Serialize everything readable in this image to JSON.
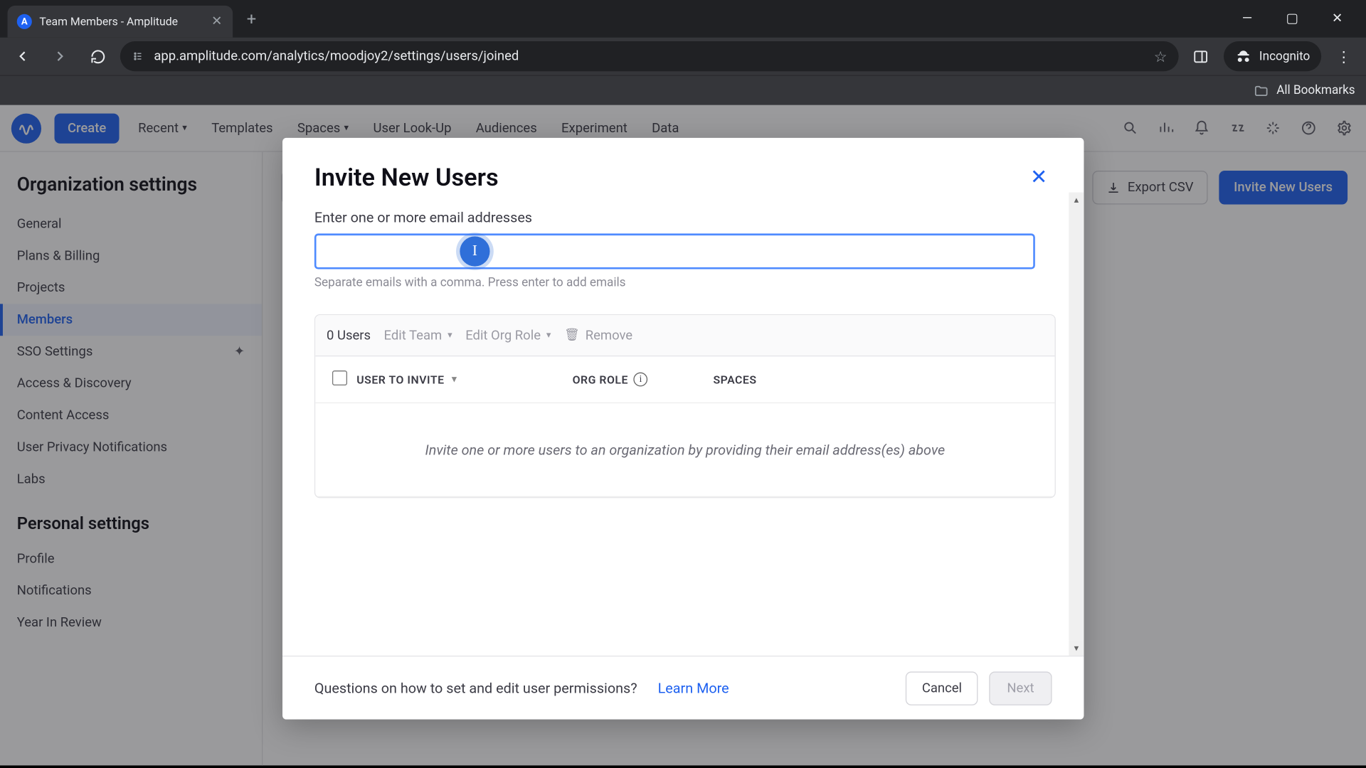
{
  "browser": {
    "tab_title": "Team Members - Amplitude",
    "url": "app.amplitude.com/analytics/moodjoy2/settings/users/joined",
    "incognito_label": "Incognito",
    "all_bookmarks": "All Bookmarks"
  },
  "app": {
    "create_label": "Create",
    "top_nav": {
      "recent": "Recent",
      "templates": "Templates",
      "spaces": "Spaces",
      "user_lookup": "User Look-Up",
      "audiences": "Audiences",
      "experiment": "Experiment",
      "data": "Data"
    },
    "sidebar": {
      "org_heading": "Organization settings",
      "personal_heading": "Personal settings",
      "items": {
        "general": "General",
        "plans": "Plans & Billing",
        "projects": "Projects",
        "members": "Members",
        "sso": "SSO Settings",
        "access": "Access & Discovery",
        "content": "Content Access",
        "privacy": "User Privacy Notifications",
        "labs": "Labs",
        "profile": "Profile",
        "notifications": "Notifications",
        "year": "Year In Review"
      }
    },
    "main": {
      "export_csv": "Export CSV",
      "invite_new_users": "Invite New Users"
    }
  },
  "modal": {
    "title": "Invite New Users",
    "field_label": "Enter one or more email addresses",
    "email_value": "",
    "hint": "Separate emails with a comma. Press enter to add emails",
    "toolbar": {
      "count": "0 Users",
      "edit_team": "Edit Team",
      "edit_org_role": "Edit Org Role",
      "remove": "Remove"
    },
    "columns": {
      "user": "USER TO INVITE",
      "org_role": "ORG ROLE",
      "spaces": "SPACES"
    },
    "empty_text": "Invite one or more users to an organization by providing their email address(es) above",
    "footer": {
      "question": "Questions on how to set and edit user permissions?",
      "learn_more": "Learn More",
      "cancel": "Cancel",
      "next": "Next"
    }
  }
}
